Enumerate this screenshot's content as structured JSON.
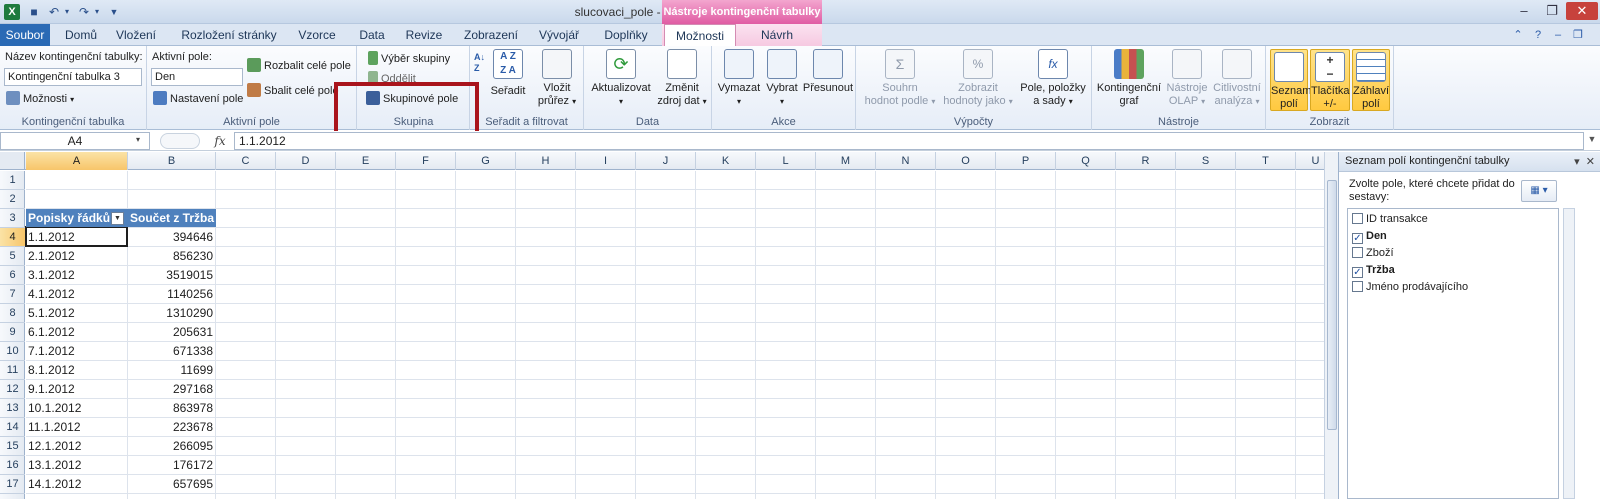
{
  "window": {
    "title": "slucovaci_pole  -  Microsoft Excel",
    "context_title": "Nástroje kontingenční tabulky"
  },
  "tabs": [
    {
      "label": "Soubor"
    },
    {
      "label": "Domů"
    },
    {
      "label": "Vložení"
    },
    {
      "label": "Rozložení stránky"
    },
    {
      "label": "Vzorce"
    },
    {
      "label": "Data"
    },
    {
      "label": "Revize"
    },
    {
      "label": "Zobrazení"
    },
    {
      "label": "Vývojář"
    },
    {
      "label": "Doplňky"
    },
    {
      "label": "Možnosti"
    },
    {
      "label": "Návrh"
    }
  ],
  "ribbon": {
    "pivot_group": {
      "name_label": "Název kontingenční tabulky:",
      "name_value": "Kontingenční tabulka 3",
      "options_label": "Možnosti",
      "group_label": "Kontingenční tabulka"
    },
    "active_field_group": {
      "label": "Aktivní pole:",
      "value": "Den",
      "settings_label": "Nastavení pole",
      "expand_label": "Rozbalit celé pole",
      "collapse_label": "Sbalit celé pole",
      "group_label": "Aktivní pole"
    },
    "group_group": {
      "selection_label": "Výběr skupiny",
      "ungroup_label": "Oddělit",
      "group_field_label": "Skupinové pole",
      "group_label": "Skupina"
    },
    "sort_group": {
      "sort_label": "Seřadit",
      "slicer_label_1": "Vložit",
      "slicer_label_2": "průřez",
      "group_label": "Seřadit a filtrovat"
    },
    "data_group": {
      "refresh_label": "Aktualizovat",
      "change_source_1": "Změnit",
      "change_source_2": "zdroj dat",
      "group_label": "Data"
    },
    "actions_group": {
      "clear_label": "Vymazat",
      "select_label": "Vybrat",
      "move_label": "Přesunout",
      "group_label": "Akce"
    },
    "calc_group": {
      "summary_1": "Souhrn",
      "summary_2": "hodnot podle",
      "show_as_1": "Zobrazit",
      "show_as_2": "hodnoty jako",
      "fields_1": "Pole, položky",
      "fields_2": "a sady",
      "group_label": "Výpočty"
    },
    "tools_group": {
      "chart_1": "Kontingenční",
      "chart_2": "graf",
      "olap_1": "Nástroje",
      "olap_2": "OLAP",
      "whatif_1": "Citlivostní",
      "whatif_2": "analýza",
      "group_label": "Nástroje"
    },
    "show_group": {
      "field_list_1": "Seznam",
      "field_list_2": "polí",
      "buttons_1": "Tlačítka",
      "buttons_2": "+/-",
      "headers_1": "Záhlaví",
      "headers_2": "polí",
      "group_label": "Zobrazit"
    }
  },
  "formula_bar": {
    "name_box": "A4",
    "fx": "fx",
    "value": "1.1.2012"
  },
  "sheet": {
    "columns": [
      "A",
      "B",
      "C",
      "D",
      "E",
      "F",
      "G",
      "H",
      "I",
      "J",
      "K",
      "L",
      "M",
      "N",
      "O",
      "P",
      "Q",
      "R",
      "S",
      "T",
      "U"
    ],
    "rows": [
      "1",
      "2",
      "3",
      "4",
      "5",
      "6",
      "7",
      "8",
      "9",
      "10",
      "11",
      "12",
      "13",
      "14",
      "15",
      "16",
      "17"
    ],
    "pivot_headers": {
      "row_labels": "Popisky řádků",
      "sum_label": "Součet z Tržba"
    },
    "pivot_rows": [
      {
        "date": "1.1.2012",
        "value": "394646"
      },
      {
        "date": "2.1.2012",
        "value": "856230"
      },
      {
        "date": "3.1.2012",
        "value": "3519015"
      },
      {
        "date": "4.1.2012",
        "value": "1140256"
      },
      {
        "date": "5.1.2012",
        "value": "1310290"
      },
      {
        "date": "6.1.2012",
        "value": "205631"
      },
      {
        "date": "7.1.2012",
        "value": "671338"
      },
      {
        "date": "8.1.2012",
        "value": "11699"
      },
      {
        "date": "9.1.2012",
        "value": "297168"
      },
      {
        "date": "10.1.2012",
        "value": "863978"
      },
      {
        "date": "11.1.2012",
        "value": "223678"
      },
      {
        "date": "12.1.2012",
        "value": "266095"
      },
      {
        "date": "13.1.2012",
        "value": "176172"
      },
      {
        "date": "14.1.2012",
        "value": "657695"
      }
    ]
  },
  "field_pane": {
    "title": "Seznam polí kontingenční tabulky",
    "instruction": "Zvolte pole, které chcete přidat do sestavy:",
    "fields": [
      {
        "label": "ID transakce",
        "checked": false
      },
      {
        "label": "Den",
        "checked": true
      },
      {
        "label": "Zboží",
        "checked": false
      },
      {
        "label": "Tržba",
        "checked": true
      },
      {
        "label": "Jméno prodávajícího",
        "checked": false
      }
    ]
  },
  "colors": {
    "accent": "#2a6ab5",
    "context_tab": "#e05ca3",
    "pivot_header": "#4f81bd",
    "highlight": "#a9141c",
    "selected_header": "#f7c56a"
  }
}
